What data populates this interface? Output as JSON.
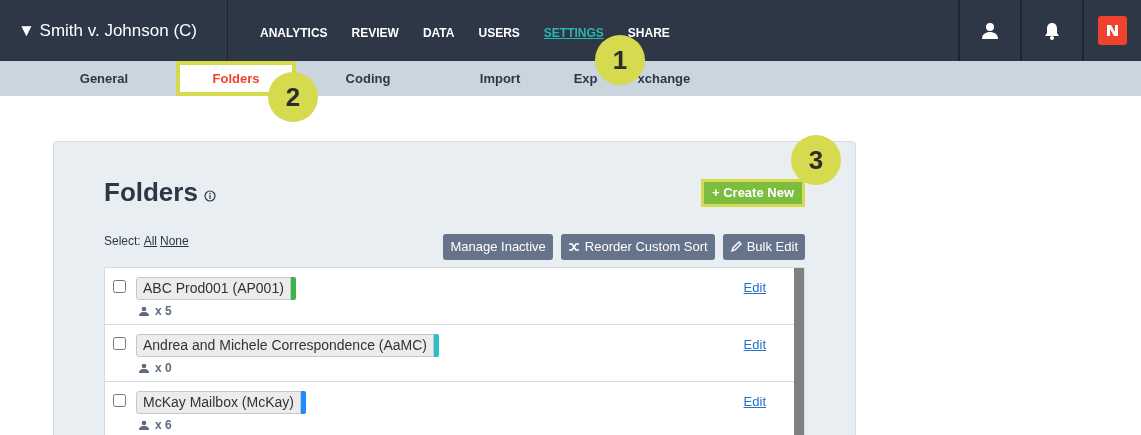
{
  "case_menu": {
    "label": "▼ Smith v. Johnson (C)"
  },
  "nav": [
    {
      "label": "ANALYTICS",
      "selected": false
    },
    {
      "label": "REVIEW",
      "selected": false
    },
    {
      "label": "DATA",
      "selected": false
    },
    {
      "label": "USERS",
      "selected": false
    },
    {
      "label": "SETTINGS",
      "selected": true
    },
    {
      "label": "SHARE",
      "selected": false
    }
  ],
  "subnav": [
    {
      "label": "General",
      "selected": false
    },
    {
      "label": "Folders",
      "selected": true
    },
    {
      "label": "Coding",
      "selected": false
    },
    {
      "label": "Import",
      "selected": false
    },
    {
      "label_parts": [
        "Exp",
        "xchange"
      ],
      "selected": false
    }
  ],
  "callouts": [
    "1",
    "2",
    "3"
  ],
  "page": {
    "title": "Folders",
    "create_button": "+ Create New",
    "select_label": "Select:",
    "select_all": "All",
    "select_none": "None",
    "actions": [
      {
        "kind": "plain",
        "label": "Manage Inactive"
      },
      {
        "kind": "shuffle",
        "label": "Reorder Custom Sort"
      },
      {
        "kind": "pencil",
        "label": "Bulk Edit"
      }
    ],
    "folders": [
      {
        "name": "ABC Prod001 (AP001)",
        "color": "#3bb54a",
        "users": "x 5",
        "checked": false,
        "edit": "Edit"
      },
      {
        "name": "Andrea and Michele Correspondence (AaMC)",
        "color": "#26c1c9",
        "users": "x 0",
        "checked": false,
        "edit": "Edit"
      },
      {
        "name": "McKay Mailbox (McKay)",
        "color": "#1a8cff",
        "users": "x 6",
        "checked": false,
        "edit": "Edit"
      }
    ]
  }
}
